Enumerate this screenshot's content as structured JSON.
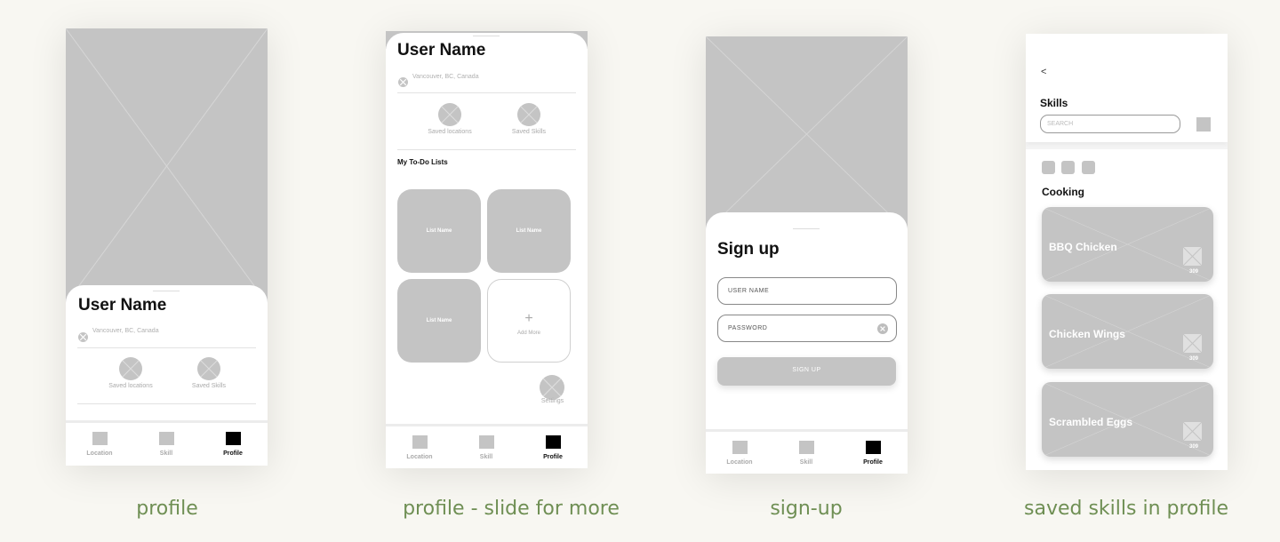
{
  "captions": [
    "profile",
    "profile - slide for more",
    "sign-up",
    "saved skills in profile"
  ],
  "profile": {
    "user_name": "User Name",
    "location": "Vancouver, BC, Canada",
    "saved_locations": "Saved locations",
    "saved_skills": "Saved Skills"
  },
  "profile_more": {
    "user_name": "User Name",
    "location": "Vancouver, BC, Canada",
    "saved_locations": "Saved locations",
    "saved_skills": "Saved Skills",
    "todo_heading": "My To-Do Lists",
    "lists": [
      "List Name",
      "List Name",
      "List Name"
    ],
    "add_more": "Add More",
    "add_symbol": "+",
    "settings": "Settings"
  },
  "signup": {
    "title": "Sign up",
    "username_placeholder": "USER NAME",
    "password_placeholder": "PASSWORD",
    "button": "SIGN UP"
  },
  "nav": {
    "location": "Location",
    "skill": "Skill",
    "profile": "Profile"
  },
  "skills_screen": {
    "back": "<",
    "title": "Skills",
    "search_placeholder": "SEARCH",
    "category": "Cooking",
    "items": [
      {
        "name": "BBQ Chicken",
        "count": "309"
      },
      {
        "name": "Chicken Wings",
        "count": "309"
      },
      {
        "name": "Scrambled Eggs",
        "count": "309"
      }
    ]
  },
  "colors": {
    "background": "#f8f7f2",
    "placeholder_grey": "#c4c4c4",
    "caption_green": "#6f8f54",
    "active_nav": "#000000"
  }
}
